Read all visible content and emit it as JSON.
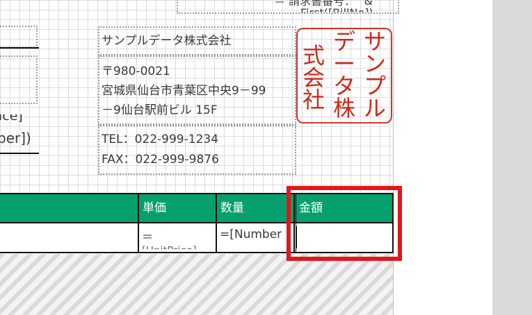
{
  "top_right_fragment": {
    "line1": "＝ 請求書番号： \"&",
    "line2": "First([BillNo])"
  },
  "left_fragments": {
    "price_text": "ice]",
    "number_text": "ber])"
  },
  "company": {
    "name": "サンプルデータ株式会社",
    "postal": "〒980-0021",
    "address_line1": "宮城県仙台市青葉区中央9－99",
    "address_line2": "－9仙台駅前ビル 15F",
    "tel": "TEL：022-999-1234",
    "fax": "FAX：022-999-9876"
  },
  "stamp": {
    "columns": [
      [
        "式",
        "会",
        "社"
      ],
      [
        "デ",
        "ー",
        "タ",
        "株"
      ],
      [
        "サ",
        "ン",
        "プ",
        "ル"
      ]
    ],
    "color": "#cc2a1a"
  },
  "table": {
    "header_color": "#05a06e",
    "headers": {
      "unit_price": "単価",
      "quantity": "数量",
      "amount": "金額"
    },
    "row": {
      "unit_price": "＝",
      "unit_price_under": "[UnitPrice]",
      "quantity": "=[Number"
    }
  },
  "highlight_color": "#e2161c"
}
